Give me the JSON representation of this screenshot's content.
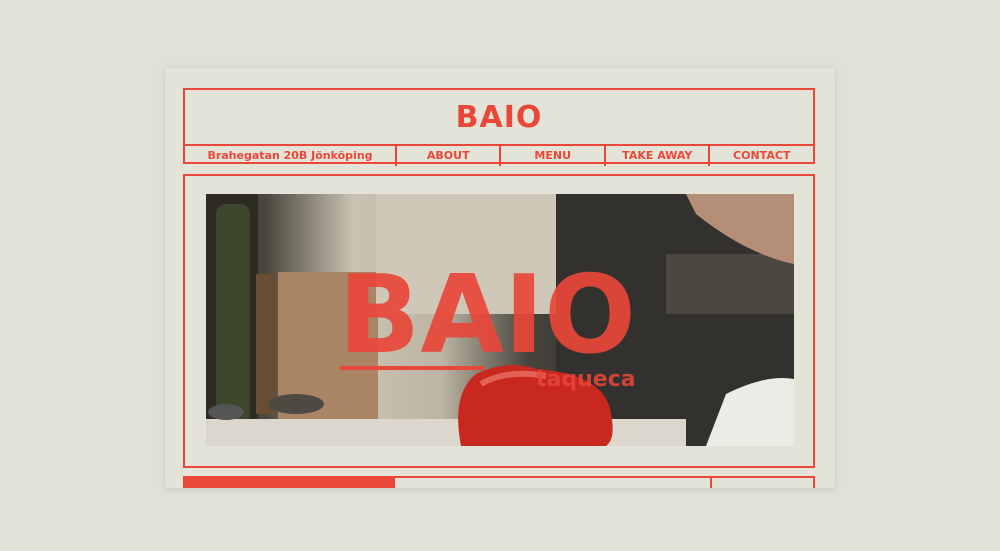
{
  "brand": {
    "logo_text": "BAIO",
    "hero_logo_text": "BAIO",
    "hero_subtitle": "taqueca",
    "accent_color": "#e9473a"
  },
  "header": {
    "address": "Brahegatan 20B Jönköping"
  },
  "nav": {
    "items": [
      {
        "label": "ABOUT"
      },
      {
        "label": "MENU"
      },
      {
        "label": "TAKE AWAY"
      },
      {
        "label": "CONTACT"
      }
    ]
  }
}
